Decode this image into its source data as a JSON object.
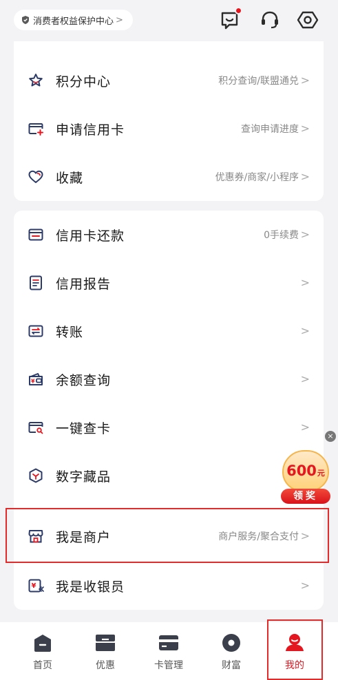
{
  "header": {
    "consumer_center": "消费者权益保护中心",
    "consumer_chevron": ">",
    "icons": [
      "message-icon",
      "customer-service-icon",
      "settings-icon"
    ]
  },
  "card1": {
    "items": [
      {
        "label": "积分中心",
        "desc": "积分查询/联盟通兑",
        "icon": "star-icon"
      },
      {
        "label": "申请信用卡",
        "desc": "查询申请进度",
        "icon": "card-add-icon"
      },
      {
        "label": "收藏",
        "desc": "优惠券/商家/小程序",
        "icon": "heart-icon"
      }
    ]
  },
  "card2": {
    "items": [
      {
        "label": "信用卡还款",
        "desc": "0手续费",
        "icon": "card-repay-icon"
      },
      {
        "label": "信用报告",
        "desc": "",
        "icon": "report-icon"
      },
      {
        "label": "转账",
        "desc": "",
        "icon": "transfer-icon"
      },
      {
        "label": "余额查询",
        "desc": "",
        "icon": "wallet-icon"
      },
      {
        "label": "一键查卡",
        "desc": "",
        "icon": "card-search-icon"
      },
      {
        "label": "数字藏品",
        "desc": "",
        "icon": "cube-icon"
      }
    ]
  },
  "card3": {
    "items": [
      {
        "label": "我是商户",
        "desc": "商户服务/聚合支付",
        "icon": "shop-icon"
      },
      {
        "label": "我是收银员",
        "desc": "",
        "icon": "cashier-icon"
      }
    ]
  },
  "arrow": ">",
  "promo": {
    "amount": "600",
    "unit": "元",
    "cta": "领奖",
    "close": "×"
  },
  "tabs": [
    {
      "label": "首页",
      "icon": "home-icon"
    },
    {
      "label": "优惠",
      "icon": "coupon-icon"
    },
    {
      "label": "卡管理",
      "icon": "card-icon"
    },
    {
      "label": "财富",
      "icon": "wealth-icon"
    },
    {
      "label": "我的",
      "icon": "profile-icon"
    }
  ],
  "colors": {
    "accent": "#e4161f",
    "icon_navy": "#2b3a67",
    "icon_red": "#e4161f",
    "tab_grey": "#3a3f4b"
  }
}
